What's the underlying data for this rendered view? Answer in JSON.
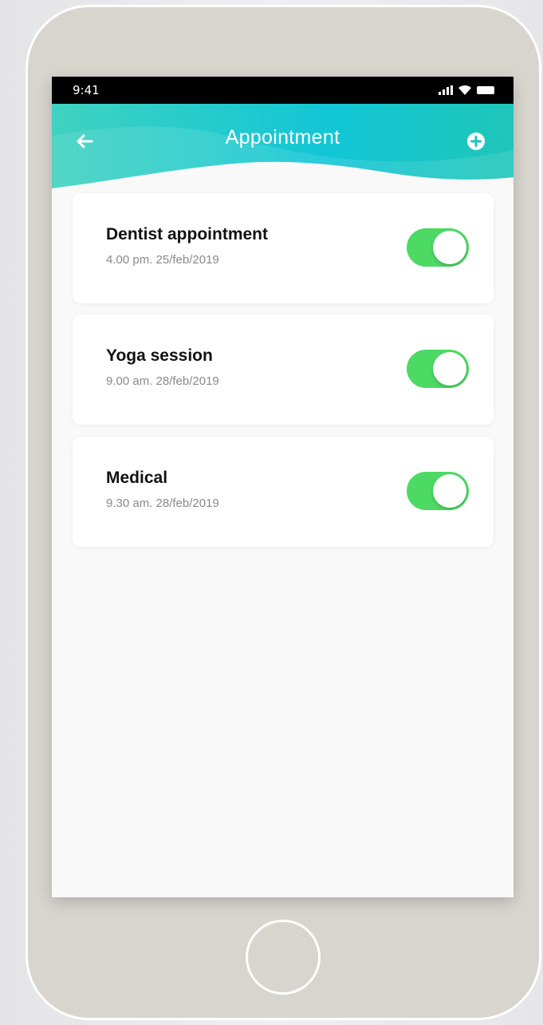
{
  "status_bar": {
    "time": "9:41",
    "icons": [
      "signal-icon",
      "wifi-icon",
      "battery-icon"
    ]
  },
  "header": {
    "title": "Appointment",
    "back_icon": "arrow-left-icon",
    "add_icon": "plus-circle-icon",
    "gradient_colors": [
      "#3fd2c0",
      "#12c6d6",
      "#1fc6b8"
    ]
  },
  "appointments": [
    {
      "title": "Dentist appointment",
      "datetime": "4.00 pm. 25/feb/2019",
      "enabled": true
    },
    {
      "title": "Yoga session",
      "datetime": "9.00 am. 28/feb/2019",
      "enabled": true
    },
    {
      "title": "Medical",
      "datetime": "9.30 am. 28/feb/2019",
      "enabled": true
    }
  ],
  "colors": {
    "toggle_on": "#4cd964",
    "device_body": "#d8d4ce",
    "screen_background": "#f9f9f9"
  }
}
